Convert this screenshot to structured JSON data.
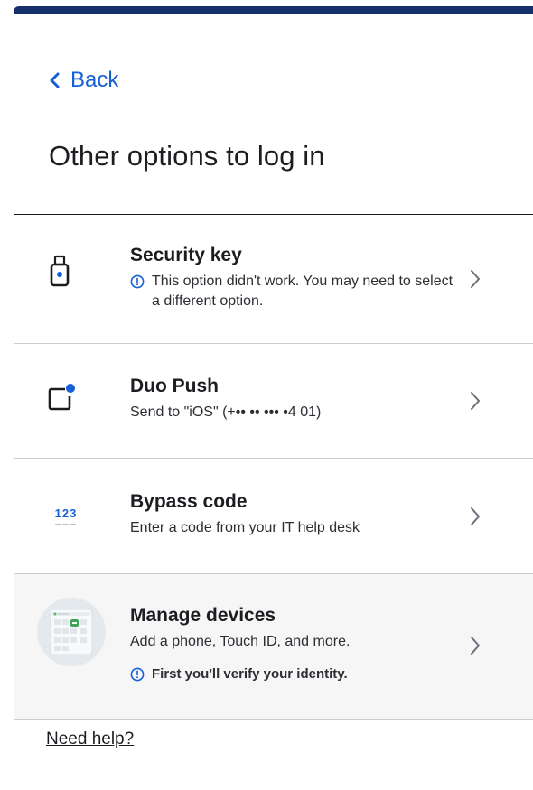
{
  "back": {
    "label": "Back"
  },
  "page": {
    "title": "Other options to log in"
  },
  "options": [
    {
      "title": "Security key",
      "notice": "This option didn't work. You may need to select a different option."
    },
    {
      "title": "Duo Push",
      "desc": "Send to \"iOS\" (+•• •• ••• •4 01)"
    },
    {
      "title": "Bypass code",
      "desc": "Enter a code from your IT help desk",
      "icon_text": "123"
    },
    {
      "title": "Manage devices",
      "desc": "Add a phone, Touch ID, and more.",
      "notice": "First you'll verify your identity."
    }
  ],
  "help": {
    "label": "Need help?"
  },
  "colors": {
    "accent": "#1560d6",
    "top_bar": "#15306b",
    "text": "#1b1d21"
  }
}
